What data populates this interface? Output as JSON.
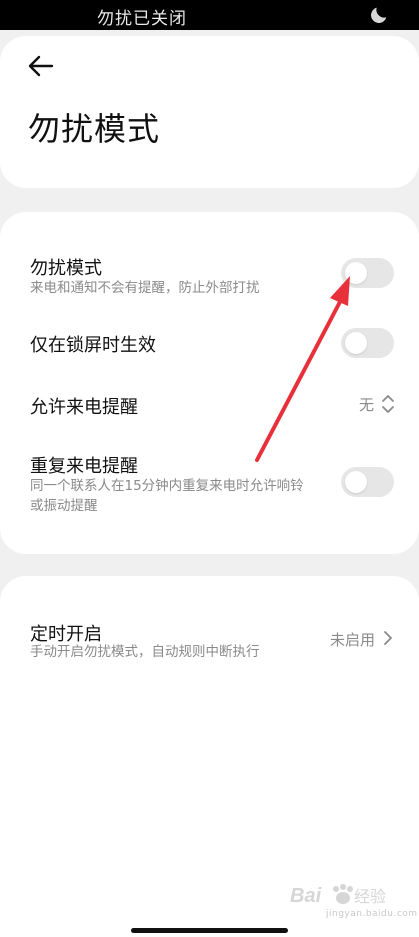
{
  "status_bar": {
    "text": "勿扰已关闭",
    "icon": "moon-icon"
  },
  "header": {
    "back_icon": "arrow-left-icon",
    "title": "勿扰模式"
  },
  "settings": {
    "dnd": {
      "title": "勿扰模式",
      "desc": "来电和通知不会有提醒，防止外部打扰",
      "enabled": false
    },
    "lock_screen_only": {
      "title": "仅在锁屏时生效",
      "enabled": false
    },
    "allow_calls": {
      "title": "允许来电提醒",
      "value": "无",
      "icon": "updown-icon"
    },
    "repeat_calls": {
      "title": "重复来电提醒",
      "desc_line1": "同一个联系人在15分钟内重复来电时允许响铃",
      "desc_line2": "或振动提醒",
      "enabled": false
    }
  },
  "schedule": {
    "title": "定时开启",
    "desc": "手动开启勿扰模式，自动规则中断执行",
    "value": "未启用",
    "icon": "chevron-right-icon"
  },
  "watermark": {
    "logo_text": "Bai 经验",
    "url": "jingyan.baidu.com"
  },
  "colors": {
    "background": "#f0f0f0",
    "card": "#ffffff",
    "toggle_off": "#e6e6e6",
    "annotation_arrow": "#e8303a",
    "secondary_text": "#8a8a8a"
  }
}
